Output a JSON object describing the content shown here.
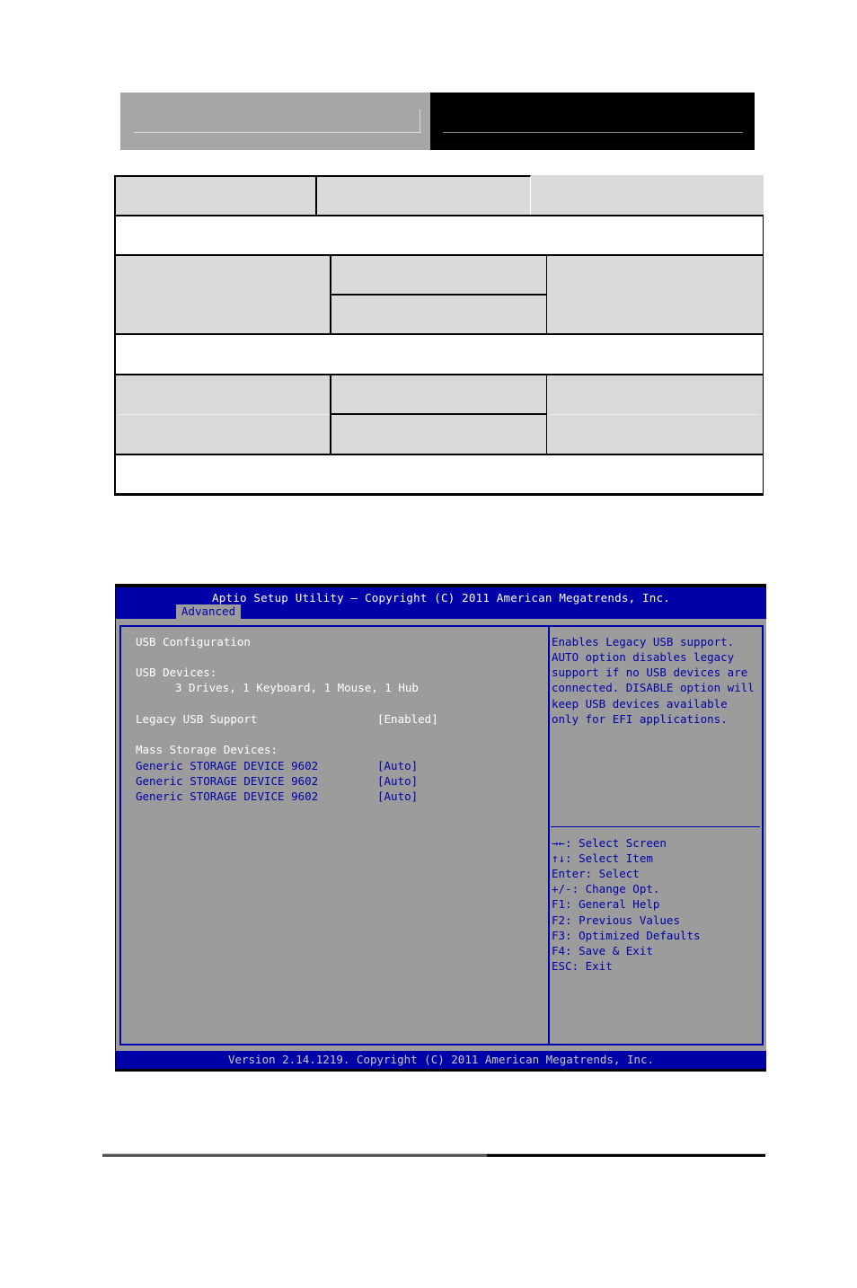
{
  "page_header": {
    "left_text": "",
    "right_text": ""
  },
  "option_table": {
    "rows": [
      {
        "cells": [
          "",
          "",
          ""
        ]
      },
      {
        "cells": [
          ""
        ]
      },
      {
        "cells": [
          "",
          "",
          "",
          ""
        ]
      },
      {
        "cells": [
          ""
        ]
      },
      {
        "cells": [
          "",
          "",
          "",
          ""
        ]
      },
      {
        "cells": [
          ""
        ]
      }
    ]
  },
  "bios": {
    "title": "Aptio Setup Utility – Copyright (C) 2011 American Megatrends, Inc.",
    "active_tab": "Advanced",
    "colors": {
      "frame": "#0000a8",
      "background": "#9c9c9c",
      "highlight_text": "#ffffff"
    },
    "main": {
      "heading": "USB Configuration",
      "usb_devices_label": "USB Devices:",
      "usb_devices_value": "3 Drives, 1 Keyboard, 1 Mouse, 1 Hub",
      "legacy_usb": {
        "label": "Legacy USB Support",
        "value": "[Enabled]"
      },
      "mass_storage_label": "Mass Storage Devices:",
      "mass_storage_devices": [
        {
          "label": "Generic STORAGE DEVICE 9602",
          "value": "[Auto]"
        },
        {
          "label": "Generic STORAGE DEVICE 9602",
          "value": "[Auto]"
        },
        {
          "label": "Generic STORAGE DEVICE 9602",
          "value": "[Auto]"
        }
      ]
    },
    "help_text": [
      "Enables Legacy USB support.",
      "AUTO option disables legacy",
      "support if no USB devices are",
      "connected. DISABLE option will",
      "keep USB devices available",
      "only for EFI applications."
    ],
    "key_help": [
      "→←: Select Screen",
      "↑↓: Select Item",
      "Enter: Select",
      "+/-: Change Opt.",
      "F1: General Help",
      "F2: Previous Values",
      "F3: Optimized Defaults",
      "F4: Save & Exit",
      "ESC: Exit"
    ],
    "footer": "Version 2.14.1219. Copyright (C) 2011 American Megatrends, Inc."
  }
}
